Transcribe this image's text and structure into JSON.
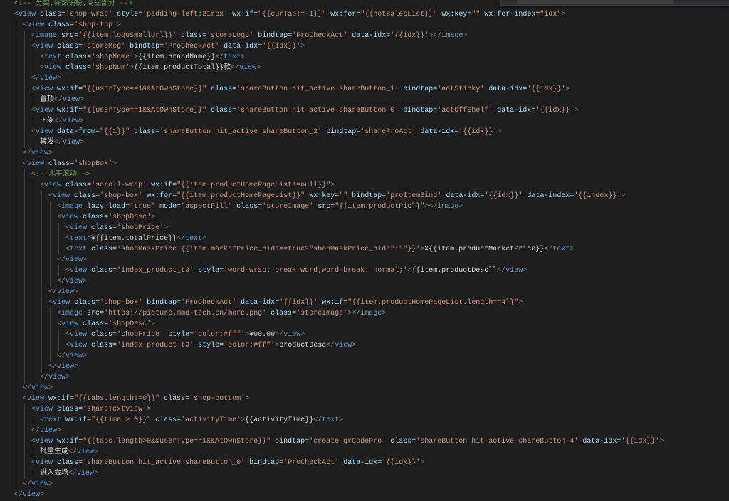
{
  "editor": {
    "language": "wxml",
    "lines": [
      {
        "indent": 0,
        "text": "<!-- 分类,除热销榜,商品部分 -->"
      },
      {
        "indent": 0,
        "text": "<view class='shop-wrap' style='padding-left:21rpx' wx:if=\"{{curTab!=-1}}\" wx:for=\"{{hotSalesList}}\" wx:key=\"\" wx:for-index=\"idx\">"
      },
      {
        "indent": 1,
        "text": "<view class='shop-top'>"
      },
      {
        "indent": 2,
        "text": "<image src='{{item.logoSmallUrl}}' class='storeLogo' bindtap='ProCheckAct' data-idx='{{idx}}'></image>"
      },
      {
        "indent": 2,
        "text": "<view class='storeMsg' bindtap='ProCheckAct' data-idx='{{idx}}'>"
      },
      {
        "indent": 3,
        "text": "<text class='shopName'>{{item.brandName}}</text>"
      },
      {
        "indent": 3,
        "text": "<view class='shopNum'>{{item.productTotal}}款</view>"
      },
      {
        "indent": 2,
        "text": "</view>"
      },
      {
        "indent": 2,
        "text": "<view wx:if=\"{{userType==1&&AtOwnStore}}\" class='shareButton hit_active shareButton_1' bindtap='actSticky' data-idx='{{idx}}'>"
      },
      {
        "indent": 3,
        "text": "置顶</view>"
      },
      {
        "indent": 2,
        "text": "<view wx:if=\"{{userType==1&&AtOwnStore}}\" class='shareButton hit_active shareButton_0' bindtap='actOffShelf' data-idx='{{idx}}'>"
      },
      {
        "indent": 3,
        "text": "下架</view>"
      },
      {
        "indent": 2,
        "text": "<view data-from=\"{{1}}\" class='shareButton hit_active shareButton_2' bindtap='shareProAct' data-idx='{{idx}}'>"
      },
      {
        "indent": 3,
        "text": "转发</view>"
      },
      {
        "indent": 1,
        "text": "</view>"
      },
      {
        "indent": 1,
        "text": "<view class='shopBox'>"
      },
      {
        "indent": 2,
        "text": "<!--水平滚动-->"
      },
      {
        "indent": 3,
        "text": "<view class='scroll-wrap' wx:if=\"{{item.productHomePageList!=null}}\">"
      },
      {
        "indent": 4,
        "text": "<view class='shop-box' wx:for=\"{{item.productHomePageList}}\" wx:key=\"\" bindtap='proItemBind' data-idx='{{idx}}' data-index='{{index}}'>"
      },
      {
        "indent": 5,
        "text": "<image lazy-load='true' mode=\"aspectFill\" class='storeImage' src=\"{{item.productPic}}\"></image>"
      },
      {
        "indent": 5,
        "text": "<view class='shopDesc'>"
      },
      {
        "indent": 6,
        "text": "<view class='shopPrice'>"
      },
      {
        "indent": 6,
        "text": "<text>¥{{item.totalPrice}}</text>"
      },
      {
        "indent": 6,
        "text": "<text class='shopMaskPrice {{item.marketPrice_hide==true?\"shopMaskPrice_hide\":\"\"}}'>¥{{item.productMarketPrice}}</text>"
      },
      {
        "indent": 5,
        "text": "</view>"
      },
      {
        "indent": 6,
        "text": "<view class='index_product_t3' style='word-wrap: break-word;word-break: normal;'>{{item.productDesc}}</view>"
      },
      {
        "indent": 5,
        "text": "</view>"
      },
      {
        "indent": 4,
        "text": "</view>"
      },
      {
        "indent": 4,
        "text": "<view class='shop-box' bindtap='ProCheckAct' data-idx='{{idx}}' wx:if=\"{{item.productHomePageList.length==4}}\">"
      },
      {
        "indent": 5,
        "text": "<image src='https://picture.mmd-tech.cn/more.png' class='storeImage'></image>"
      },
      {
        "indent": 5,
        "text": "<view class='shopDesc'>"
      },
      {
        "indent": 6,
        "text": "<view class='shopPrice' style='color:#fff'>¥00.00</view>"
      },
      {
        "indent": 6,
        "text": "<view class='index_product_t3' style='color:#fff'>productDesc</view>"
      },
      {
        "indent": 5,
        "text": "</view>"
      },
      {
        "indent": 4,
        "text": "</view>"
      },
      {
        "indent": 3,
        "text": "</view>"
      },
      {
        "indent": 1,
        "text": "</view>"
      },
      {
        "indent": 1,
        "text": "<view wx:if=\"{{tabs.length!=0}}\" class='shop-bottom'>"
      },
      {
        "indent": 2,
        "text": "<view class='shareTextView'>"
      },
      {
        "indent": 3,
        "text": "<text wx:if=\"{{time > 0}}\" class='activityTime'>{{activityTime}}</text>"
      },
      {
        "indent": 2,
        "text": "</view>"
      },
      {
        "indent": 2,
        "text": "<view wx:if=\"{{tabs.length>0&&userType==1&&AtOwnStore}}\" bindtap='create_qrCodePro' class='shareButton hit_active shareButton_4' data-idx='{{idx}}'>"
      },
      {
        "indent": 3,
        "text": "批量生成</view>"
      },
      {
        "indent": 2,
        "text": "<view class='shareButton hit_active shareButton_0' bindtap='ProCheckAct' data-idx='{{idx}}'>"
      },
      {
        "indent": 3,
        "text": "进入会场</view>"
      },
      {
        "indent": 1,
        "text": "</view>"
      },
      {
        "indent": 0,
        "text": "</view>"
      }
    ]
  }
}
